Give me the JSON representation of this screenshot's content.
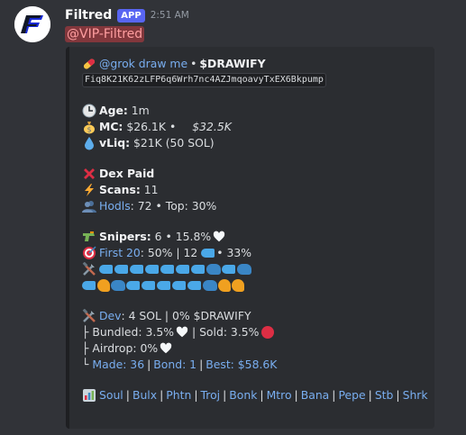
{
  "header": {
    "username": "Filtred",
    "badge": "APP",
    "timestamp": "2:51 AM",
    "mention": "@VIP-Filtred"
  },
  "embed": {
    "line1": {
      "link": "@grok draw me",
      "bullet": "•",
      "ticker": "$DRAWIFY"
    },
    "contract": "Fiq8K21K62zLFP6q6Wrh7nc4AZJmqoavyTxEX6Bkpump",
    "age": {
      "label": "Age:",
      "value": "1m"
    },
    "mc": {
      "label": "MC:",
      "value": "$26.1K",
      "bullet": "•",
      "ath": "$32.5K"
    },
    "vliq": {
      "label": "vLiq:",
      "value": "$21K (50 SOL)"
    },
    "dex_paid": {
      "label": "Dex Paid"
    },
    "scans": {
      "label": "Scans:",
      "value": "11"
    },
    "hodls": {
      "link": "Hodls",
      "value": ": 72 • Top: 30%"
    },
    "snipers": {
      "label": "Snipers:",
      "value": "6 • 15.8%"
    },
    "first20": {
      "link": "First 20",
      "value": ": 50% | 12",
      "tail": "• 33%"
    },
    "dev": {
      "link": "Dev",
      "value": ": 4 SOL | 0% $DRAWIFY"
    },
    "bundled": {
      "prefix": "├ Bundled: 3.5%",
      "sold": "| Sold: 3.5%"
    },
    "airdrop": {
      "prefix": "├ Airdrop: 0%"
    },
    "made": {
      "prefix": "└",
      "made": "Made: 36",
      "bond": "Bond: 1",
      "best": "Best: $58.6K"
    },
    "links": [
      "Soul",
      "Bulx",
      "Phtn",
      "Troj",
      "Bonk",
      "Mtro",
      "Bana",
      "Pepe",
      "Stb",
      "Shrk"
    ]
  },
  "colors": {
    "background": "#313338",
    "embed_background": "#2b2d31",
    "link": "#79aef0",
    "app_badge": "#5865f2",
    "mention_bg": "#f23f43"
  },
  "icons": [
    "filtred-logo-avatar",
    "pill-icon",
    "clock-icon",
    "money-bag-icon",
    "droplet-icon",
    "cross-mark-icon",
    "lightning-icon",
    "people-icon",
    "water-pistol-icon",
    "target-icon",
    "tools-icon",
    "fish-icon",
    "whale-icon",
    "dolphin-icon",
    "white-heart-icon",
    "red-circle-icon",
    "chart-icon"
  ]
}
